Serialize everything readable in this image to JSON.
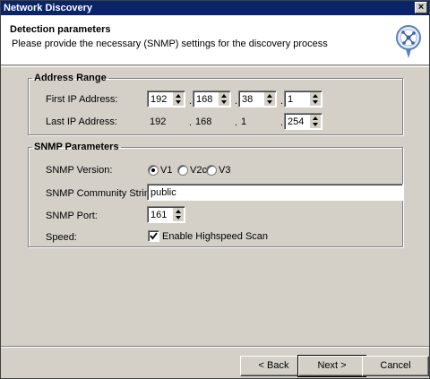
{
  "window": {
    "title": "Network Discovery",
    "close_label": "×"
  },
  "header": {
    "title": "Detection parameters",
    "subtitle": "Please provide the necessary (SNMP) settings for the discovery process",
    "icon": "network-discovery-icon"
  },
  "address_range": {
    "legend": "Address Range",
    "first_label": "First IP Address:",
    "first_ip": [
      "192",
      "168",
      "38",
      "1"
    ],
    "last_label": "Last IP Address:",
    "last_ip": [
      "192",
      "168",
      "1",
      "254"
    ],
    "dot": "."
  },
  "snmp": {
    "legend": "SNMP Parameters",
    "version_label": "SNMP Version:",
    "versions": [
      "V1",
      "V2c",
      "V3"
    ],
    "selected_version": "V1",
    "community_label": "SNMP Community String:",
    "community_value": "public",
    "port_label": "SNMP Port:",
    "port_value": "161",
    "speed_label": "Speed:",
    "highspeed_label": "Enable Highspeed Scan",
    "highspeed_checked": true
  },
  "buttons": {
    "back": "< Back",
    "next": "Next >",
    "cancel": "Cancel"
  }
}
